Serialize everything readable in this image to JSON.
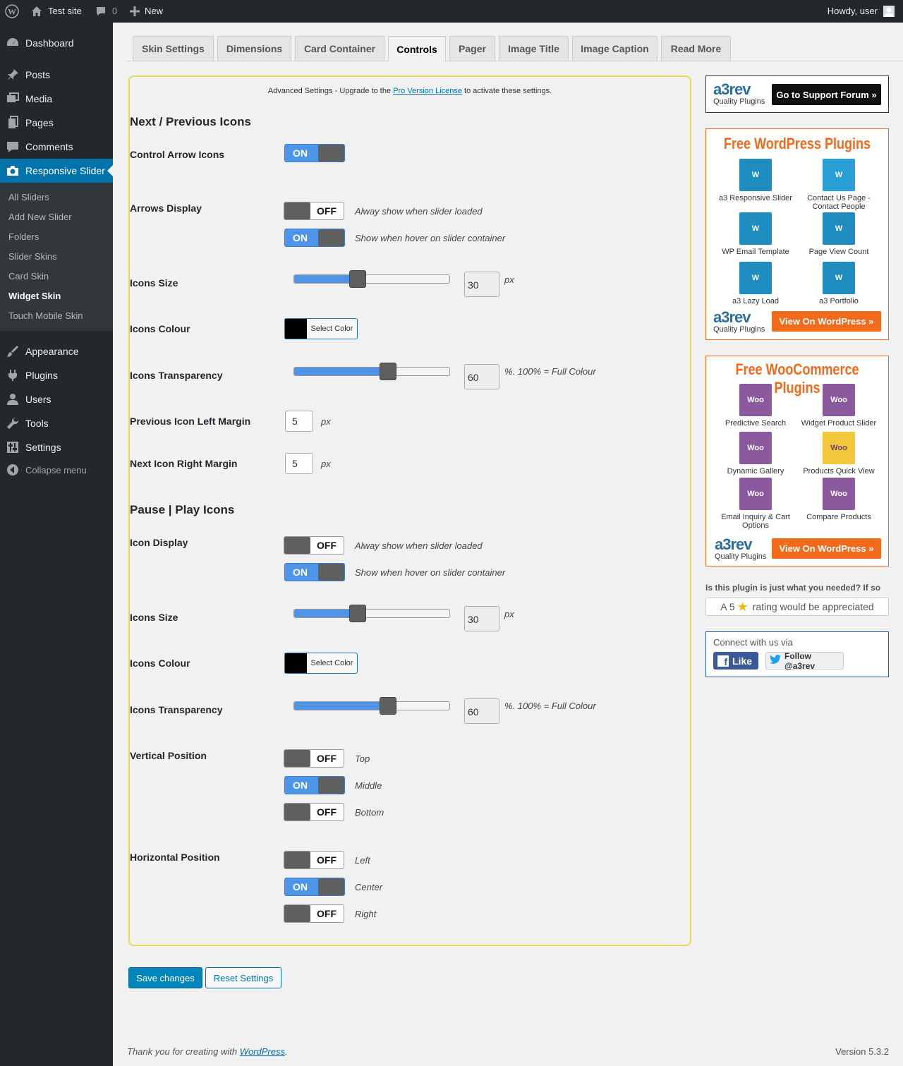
{
  "adminbar": {
    "site_name": "Test site",
    "comments_count": "0",
    "new_label": "New",
    "greeting": "Howdy, user"
  },
  "sidebar": {
    "items": [
      {
        "label": "Dashboard",
        "icon": "dashboard-icon"
      },
      {
        "label": "Posts",
        "icon": "pin-icon"
      },
      {
        "label": "Media",
        "icon": "media-icon"
      },
      {
        "label": "Pages",
        "icon": "pages-icon"
      },
      {
        "label": "Comments",
        "icon": "comment-icon"
      },
      {
        "label": "Responsive Slider",
        "icon": "camera-icon"
      },
      {
        "label": "Appearance",
        "icon": "brush-icon"
      },
      {
        "label": "Plugins",
        "icon": "plug-icon"
      },
      {
        "label": "Users",
        "icon": "user-icon"
      },
      {
        "label": "Tools",
        "icon": "wrench-icon"
      },
      {
        "label": "Settings",
        "icon": "sliders-icon"
      },
      {
        "label": "Collapse menu",
        "icon": "collapse-icon"
      }
    ],
    "submenu": [
      "All Sliders",
      "Add New Slider",
      "Folders",
      "Slider Skins",
      "Card Skin",
      "Widget Skin",
      "Touch Mobile Skin"
    ]
  },
  "tabs": [
    "Skin Settings",
    "Dimensions",
    "Card Container",
    "Controls",
    "Pager",
    "Image Title",
    "Image Caption",
    "Read More"
  ],
  "notice": {
    "before": "Advanced Settings - Upgrade to the ",
    "link": "Pro Version License",
    "after": " to activate these settings."
  },
  "sections": {
    "nav_title": "Next / Previous Icons",
    "pause_title": "Pause | Play Icons"
  },
  "fields": {
    "control_arrow": "Control Arrow Icons",
    "arrows_display": "Arrows Display",
    "icons_size": "Icons Size",
    "icons_colour": "Icons Colour",
    "icons_transparency": "Icons Transparency",
    "prev_margin": "Previous Icon Left Margin",
    "next_margin": "Next Icon Right Margin",
    "icon_display": "Icon Display",
    "vertical_position": "Vertical Position",
    "horizontal_position": "Horizontal Position"
  },
  "toggle": {
    "on": "ON",
    "off": "OFF"
  },
  "hints": {
    "always_show": "Alway show when slider loaded",
    "hover_show": "Show when hover on slider container",
    "px": "px",
    "full_colour": "%. 100% = Full Colour",
    "top": "Top",
    "middle": "Middle",
    "bottom": "Bottom",
    "left": "Left",
    "center": "Center",
    "right": "Right"
  },
  "values": {
    "nav_size": "30",
    "nav_transparency": "60",
    "prev_margin": "5",
    "next_margin": "5",
    "pause_size": "30",
    "pause_transparency": "60"
  },
  "select_color": "Select Color",
  "buttons": {
    "save": "Save changes",
    "reset": "Reset Settings"
  },
  "right": {
    "logo": "a3rev",
    "quality": "Quality Plugins",
    "support": "Go to Support Forum »",
    "free_wp": "Free WordPress Plugins",
    "wp_plugins": [
      "a3 Responsive Slider",
      "Contact Us Page - Contact People",
      "WP Email Template",
      "Page View Count",
      "a3 Lazy Load",
      "a3 Portfolio"
    ],
    "view_wp": "View On WordPress »",
    "free_woo": "Free WooCommerce Plugins",
    "woo_plugins": [
      "Predictive Search",
      "Widget Product Slider",
      "Dynamic Gallery",
      "Products Quick View",
      "Email Inquiry & Cart Options",
      "Compare Products"
    ],
    "rating_q": "Is this plugin is just what you needed? If so",
    "rating_a": "A 5",
    "rating_b": "rating would be appreciated",
    "connect": "Connect with us via",
    "like": "Like",
    "follow": "Follow @a3rev"
  },
  "footer": {
    "thanks_before": "Thank you for creating with ",
    "thanks_link": "WordPress",
    "thanks_after": ".",
    "version": "Version 5.3.2"
  },
  "colors": {
    "accent": "#0073aa",
    "toggle_on": "#4f94e6",
    "border_yellow": "#e6db55",
    "orange": "#f26b1d"
  }
}
